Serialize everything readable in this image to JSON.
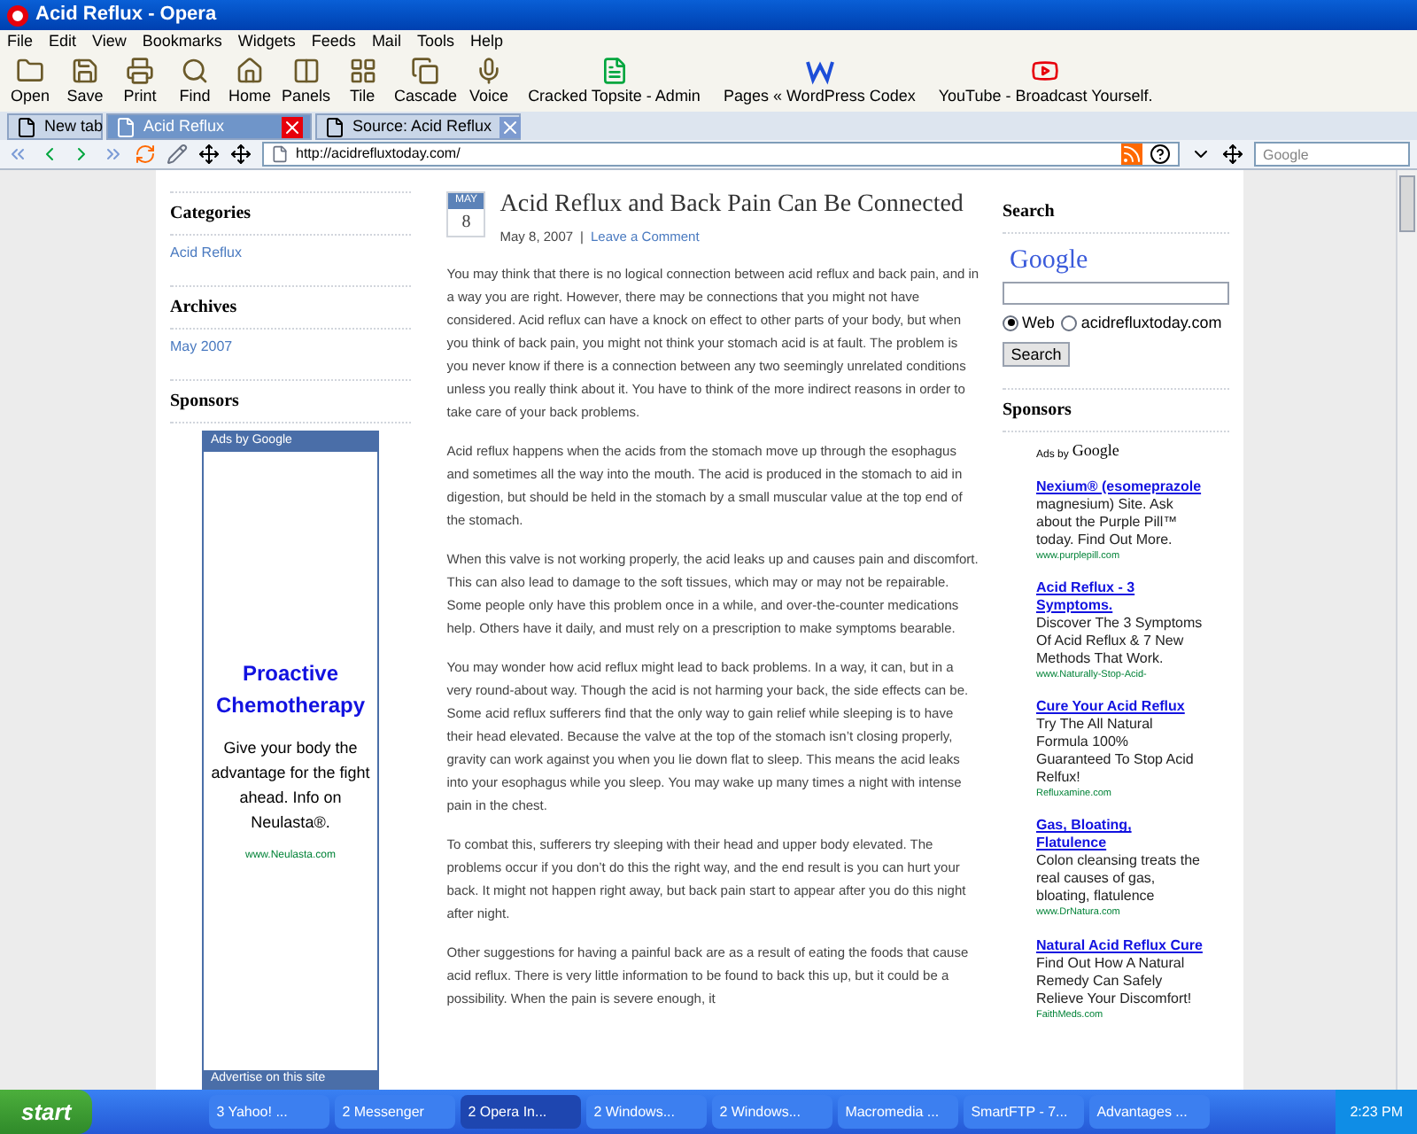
{
  "window": {
    "title": "Acid Reflux - Opera"
  },
  "menu": [
    "File",
    "Edit",
    "View",
    "Bookmarks",
    "Widgets",
    "Feeds",
    "Mail",
    "Tools",
    "Help"
  ],
  "toolbar": [
    {
      "label": "Open",
      "kind": "folder"
    },
    {
      "label": "Save",
      "kind": "save"
    },
    {
      "label": "Print",
      "kind": "print"
    },
    {
      "label": "Find",
      "kind": "find"
    },
    {
      "label": "Home",
      "kind": "home"
    },
    {
      "label": "Panels",
      "kind": "panels"
    },
    {
      "label": "Tile",
      "kind": "tile"
    },
    {
      "label": "Cascade",
      "kind": "cascade"
    },
    {
      "label": "Voice",
      "kind": "voice"
    }
  ],
  "bookmarks": [
    {
      "label": "Cracked Topsite - Admin",
      "kind": "page"
    },
    {
      "label": "Pages « WordPress Codex",
      "kind": "wordpress"
    },
    {
      "label": "YouTube - Broadcast Yourself.",
      "kind": "video"
    }
  ],
  "tabs": [
    {
      "label": "New tab",
      "selected": false,
      "closable": false
    },
    {
      "label": "Acid Reflux",
      "selected": true,
      "closable": true
    },
    {
      "label": "Source:  Acid Reflux",
      "selected": false,
      "closable": true
    }
  ],
  "address": {
    "url": "http://acidrefluxtoday.com/",
    "search_placeholder": "Google"
  },
  "left_sidebar": {
    "sections": [
      {
        "heading": "Categories",
        "links": [
          "Acid Reflux"
        ]
      },
      {
        "heading": "Archives",
        "links": [
          "May 2007"
        ]
      },
      {
        "heading": "Sponsors"
      }
    ],
    "ad": {
      "header": "Ads by Google",
      "title": "Proactive Chemotherapy",
      "body": "Give your body the advantage for the fight ahead. Info on Neulasta®.",
      "url": "www.Neulasta.com",
      "footer": "Advertise on this site"
    }
  },
  "post": {
    "month": "MAY",
    "day": "8",
    "title": "Acid Reflux and Back Pain Can Be Connected",
    "date": "May 8, 2007",
    "separator": "|",
    "comment_link": "Leave a Comment",
    "paragraphs": [
      "You may think that there is no logical connection between acid reflux and back pain, and in a way you are right. However, there may be connections that you might not have considered. Acid reflux can have a knock on effect to other parts of your body, but when you think of back pain, you might not think your stomach acid is at fault. The problem is you never know if there is a connection between any two seemingly unrelated conditions unless you really think about it. You have to think of the more indirect reasons in order to take care of your back problems.",
      "Acid reflux happens when the acids from the stomach move up through the esophagus and sometimes all the way into the mouth. The acid is produced in the stomach to aid in digestion, but should be held in the stomach by a small muscular value at the top end of the stomach.",
      "When this valve is not working properly, the acid leaks up and causes pain and discomfort. This can also lead to damage to the soft tissues, which may or may not be repairable. Some people only have this problem once in a while, and over-the-counter medications help. Others have it daily, and must rely on a prescription to make symptoms bearable.",
      "You may wonder how acid reflux might lead to back problems. In a way, it can, but in a very round-about way. Though the acid is not harming your back, the side effects can be. Some acid reflux sufferers find that the only way to gain relief while sleeping is to have their head elevated. Because the valve at the top of the stomach isn’t closing properly, gravity can work against you when you lie down flat to sleep. This means the acid leaks into your esophagus while you sleep. You may wake up many times a night with intense pain in the chest.",
      "To combat this, sufferers try sleeping with their head and upper body elevated. The problems occur if you don’t do this the right way, and the end result is you can hurt your back. It might not happen right away, but back pain start to appear after you do this night after night.",
      "Other suggestions for having a painful back are as a result of eating the foods that cause acid reflux. There is very little information to be found to back this up, but it could be a possibility. When the pain is severe enough, it"
    ]
  },
  "right_sidebar": {
    "search_heading": "Search",
    "logo": "Google",
    "options": [
      {
        "label": "Web",
        "selected": true
      },
      {
        "label": "acidrefluxtoday.com",
        "selected": false
      }
    ],
    "button": "Search",
    "sponsors_heading": "Sponsors",
    "ads_by": "Ads by",
    "ads_logo": "Google",
    "ads": [
      {
        "title": "Nexium® (esomeprazole",
        "body": "magnesium) Site. Ask about the Purple Pill™ today. Find Out More.",
        "url": "www.purplepill.com"
      },
      {
        "title": "Acid Reflux - 3 Symptoms.",
        "body": "Discover The 3 Symptoms Of Acid Reflux & 7 New Methods That Work.",
        "url": "www.Naturally-Stop-Acid-"
      },
      {
        "title": "Cure Your Acid Reflux",
        "body": "Try The All Natural Formula 100% Guaranteed To Stop Acid Relfux!",
        "url": "Refluxamine.com"
      },
      {
        "title": "Gas, Bloating, Flatulence",
        "body": "Colon cleansing treats the real causes of gas, bloating, flatulence",
        "url": "www.DrNatura.com"
      },
      {
        "title": "Natural Acid Reflux Cure",
        "body": "Find Out How A Natural Remedy Can Safely Relieve Your Discomfort!",
        "url": "FaithMeds.com"
      }
    ]
  },
  "taskbar": {
    "start": "start",
    "items": [
      {
        "label": "3 Yahoo! ...",
        "selected": false
      },
      {
        "label": "2 Messenger",
        "selected": false
      },
      {
        "label": "2 Opera In...",
        "selected": true
      },
      {
        "label": "2 Windows...",
        "selected": false
      },
      {
        "label": "2 Windows...",
        "selected": false
      },
      {
        "label": "Macromedia ...",
        "selected": false
      },
      {
        "label": "SmartFTP - 7...",
        "selected": false
      },
      {
        "label": "Advantages ...",
        "selected": false
      }
    ],
    "clock": "2:23 PM"
  }
}
